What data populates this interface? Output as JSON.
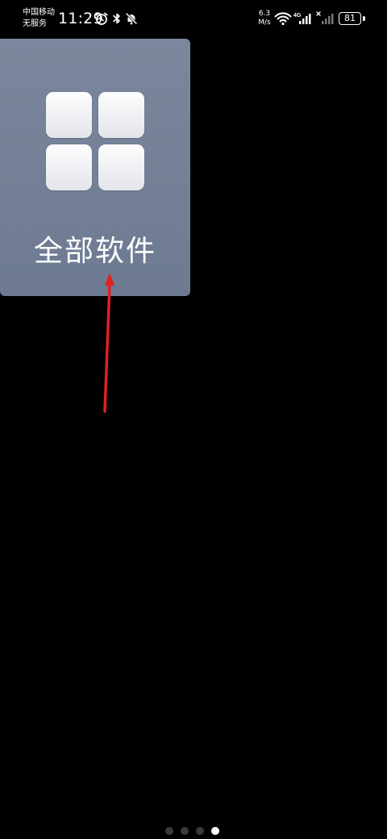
{
  "status_bar": {
    "carrier_line1": "中国移动",
    "carrier_line2": "无服务",
    "time": "11:29",
    "net_speed_value": "6.3",
    "net_speed_unit": "M/s",
    "network_type": "4G",
    "battery_level": "81",
    "icons": [
      "alarm-icon",
      "bluetooth-icon",
      "mute-notification-icon",
      "wifi-icon",
      "signal-4g-icon",
      "signal-no-service-icon",
      "battery-icon"
    ]
  },
  "app_card": {
    "label": "全部软件",
    "icon": "grid-four-squares-icon",
    "colors": {
      "card_top": "#7b879d",
      "card_bottom": "#6d7a91",
      "tile": "#f5f6f8"
    }
  },
  "annotation": {
    "icon": "red-arrow-pointer",
    "color": "#e02020"
  },
  "page_indicator": {
    "total": 4,
    "active_index": 3
  }
}
